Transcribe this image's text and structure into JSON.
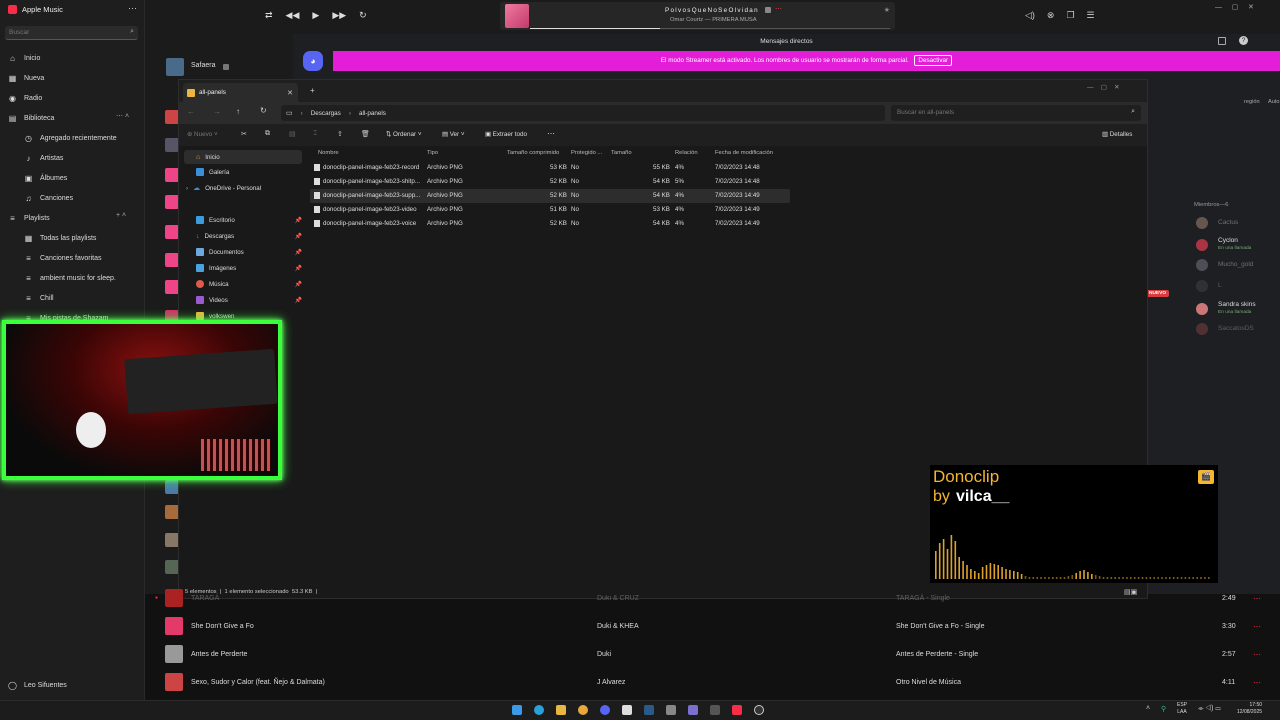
{
  "app": {
    "title": "Apple Music"
  },
  "search": {
    "placeholder": "Buscar"
  },
  "sidebar": {
    "items": [
      {
        "label": "Inicio"
      },
      {
        "label": "Nueva"
      },
      {
        "label": "Radio"
      }
    ],
    "library_label": "Biblioteca",
    "library_items": [
      {
        "label": "Agregado recientemente"
      },
      {
        "label": "Artistas"
      },
      {
        "label": "Álbumes"
      },
      {
        "label": "Canciones"
      }
    ],
    "playlists_label": "Playlists",
    "playlists": [
      {
        "label": "Todas las playlists"
      },
      {
        "label": "Canciones favoritas"
      },
      {
        "label": "ambient music for sleep."
      },
      {
        "label": "Chill"
      },
      {
        "label": "Mis pistas de Shazam"
      }
    ],
    "user": "Leo Sifuentes"
  },
  "now_playing": {
    "title": "PolvosQueNoSeOlvidan",
    "artist_album": "Omar Courtz — PRIMERA MUSA"
  },
  "discord": {
    "dm_title": "Mensajes directos",
    "streamer_banner": "El modo Streamer está activado. Los nombres de usuario se mostrarán de forma parcial.",
    "deactivate": "Desactivar",
    "region_text": "región",
    "auto_text": "Auto",
    "new_badge": "NUEVO",
    "members_header": "Miembros—6",
    "members": [
      {
        "name": "Cactus",
        "status": ""
      },
      {
        "name": "Cyclon",
        "status": "En una llamada"
      },
      {
        "name": "Mucho_gold",
        "status": ""
      },
      {
        "name": "L",
        "status": ""
      },
      {
        "name": "Sandra skins",
        "status": "En una llamada"
      },
      {
        "name": "SaccatosDS",
        "status": ""
      }
    ]
  },
  "first_song": "Safaera",
  "explorer": {
    "tab_title": "all-panels",
    "breadcrumb": [
      "Descargas",
      "all-panels"
    ],
    "search_placeholder": "Buscar en all-panels",
    "toolbar": {
      "new": "Nuevo",
      "sort": "Ordenar",
      "view": "Ver",
      "extract": "Extraer todo",
      "details": "Detalles"
    },
    "nav": [
      {
        "label": "Inicio"
      },
      {
        "label": "Galería"
      },
      {
        "label": "OneDrive - Personal"
      },
      {
        "label": "Escritorio"
      },
      {
        "label": "Descargas"
      },
      {
        "label": "Documentos"
      },
      {
        "label": "Imágenes"
      },
      {
        "label": "Música"
      },
      {
        "label": "Videos"
      },
      {
        "label": "volkswen"
      }
    ],
    "columns": [
      "Nombre",
      "Tipo",
      "Tamaño comprimido",
      "Protegido ...",
      "Tamaño",
      "Relación",
      "Fecha de modificación"
    ],
    "files": [
      {
        "name": "donoclip-panel-image-feb23-record",
        "type": "Archivo PNG",
        "compressed": "53 KB",
        "protected": "No",
        "size": "55 KB",
        "ratio": "4%",
        "date": "7/02/2023 14:48"
      },
      {
        "name": "donoclip-panel-image-feb23-shitp...",
        "type": "Archivo PNG",
        "compressed": "52 KB",
        "protected": "No",
        "size": "54 KB",
        "ratio": "5%",
        "date": "7/02/2023 14:48"
      },
      {
        "name": "donoclip-panel-image-feb23-supp...",
        "type": "Archivo PNG",
        "compressed": "52 KB",
        "protected": "No",
        "size": "54 KB",
        "ratio": "4%",
        "date": "7/02/2023 14:49"
      },
      {
        "name": "donoclip-panel-image-feb23-video",
        "type": "Archivo PNG",
        "compressed": "51 KB",
        "protected": "No",
        "size": "53 KB",
        "ratio": "4%",
        "date": "7/02/2023 14:49"
      },
      {
        "name": "donoclip-panel-image-feb23-voice",
        "type": "Archivo PNG",
        "compressed": "52 KB",
        "protected": "No",
        "size": "54 KB",
        "ratio": "4%",
        "date": "7/02/2023 14:49"
      }
    ],
    "status": "5 elementos  |  1 elemento seleccionado  53.3 KB  |"
  },
  "songs": [
    {
      "title": "TARAGÁ",
      "artist": "Duki & CRUZ",
      "album": "TARAGÁ - Single",
      "time": "2:49"
    },
    {
      "title": "She Don't Give a Fo",
      "artist": "Duki & KHEA",
      "album": "She Don't Give a Fo - Single",
      "time": "3:30"
    },
    {
      "title": "Antes de Perderte",
      "artist": "Duki",
      "album": "Antes de Perderte - Single",
      "time": "2:57"
    },
    {
      "title": "Sexo, Sudor y Calor (feat. Ñejo & Dalmata)",
      "artist": "J Alvarez",
      "album": "Otro Nivel de Música",
      "time": "4:11"
    }
  ],
  "donoclip": {
    "title": "Donoclip",
    "by": "by",
    "author": "vilca__"
  },
  "taskbar": {
    "lang1": "ESP",
    "lang2": "LAA",
    "time": "17:50",
    "date": "12/08/2025"
  },
  "colors": {
    "accent_pink": "#e41ed8",
    "discord_blue": "#5865f2",
    "webcam_green": "#3cff3c",
    "donoclip_gold": "#f5b52e"
  }
}
